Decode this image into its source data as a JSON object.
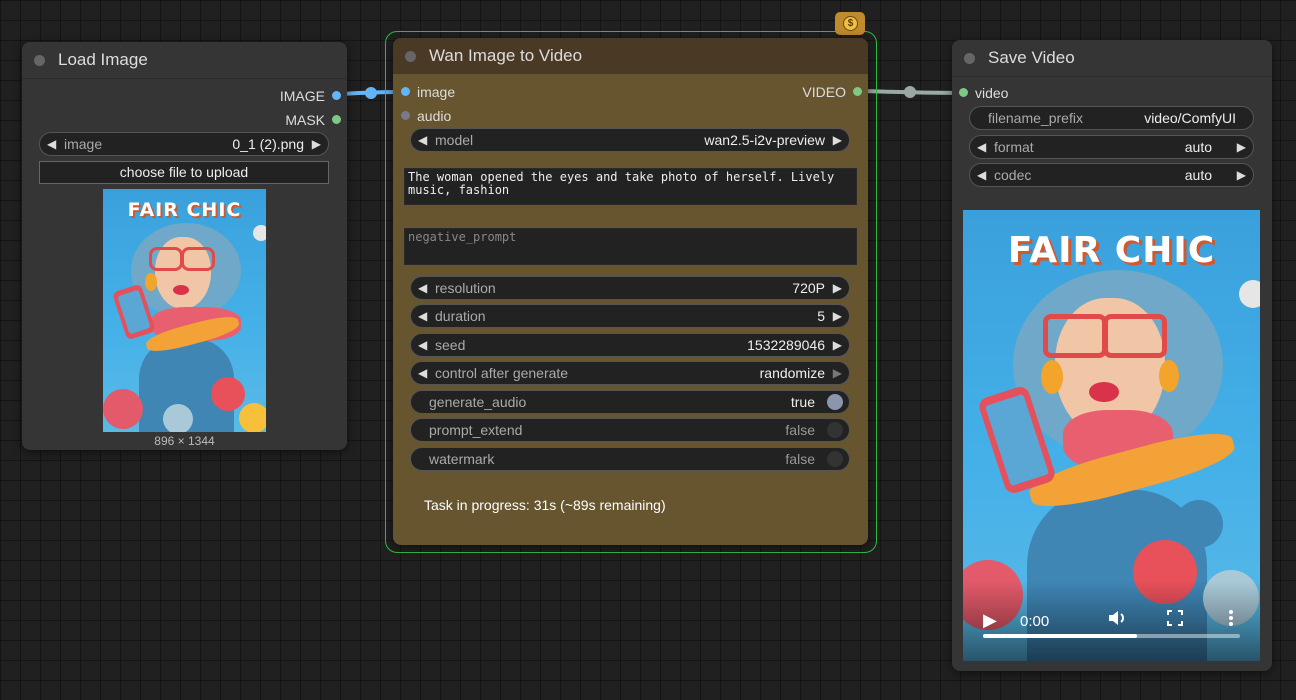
{
  "load_image": {
    "title": "Load Image",
    "outputs": [
      "IMAGE",
      "MASK"
    ],
    "image_widget": {
      "label": "image",
      "value": "0_1 (2).png"
    },
    "upload_label": "choose file to upload",
    "dimensions": "896 × 1344",
    "poster_text": "FAIR CHIC"
  },
  "wan": {
    "title": "Wan Image to Video",
    "inputs": [
      "image",
      "audio"
    ],
    "output": "VIDEO",
    "model": {
      "label": "model",
      "value": "wan2.5-i2v-preview"
    },
    "prompt": "The woman opened the eyes and take photo of herself. Lively music, fashion",
    "negative_placeholder": "negative_prompt",
    "widgets": [
      {
        "label": "resolution",
        "value": "720P"
      },
      {
        "label": "duration",
        "value": "5"
      },
      {
        "label": "seed",
        "value": "1532289046"
      },
      {
        "label": "control after generate",
        "value": "randomize"
      }
    ],
    "toggles": [
      {
        "label": "generate_audio",
        "value": "true"
      },
      {
        "label": "prompt_extend",
        "value": "false"
      },
      {
        "label": "watermark",
        "value": "false"
      }
    ],
    "status": "Task in progress: 31s (~89s remaining)",
    "badge_icon": "dollar-coin-icon"
  },
  "save_video": {
    "title": "Save Video",
    "input": "video",
    "widgets": [
      {
        "label": "filename_prefix",
        "value": "video/ComfyUI"
      },
      {
        "label": "format",
        "value": "auto"
      },
      {
        "label": "codec",
        "value": "auto"
      }
    ],
    "poster_text": "FAIR CHIC",
    "player": {
      "time": "0:00",
      "progress": 0.6
    }
  },
  "colors": {
    "image_link": "#64b5f6",
    "video_link": "#9aa9a4",
    "selected_outline": "#2fbd3f",
    "wan_body": "#66552f"
  }
}
